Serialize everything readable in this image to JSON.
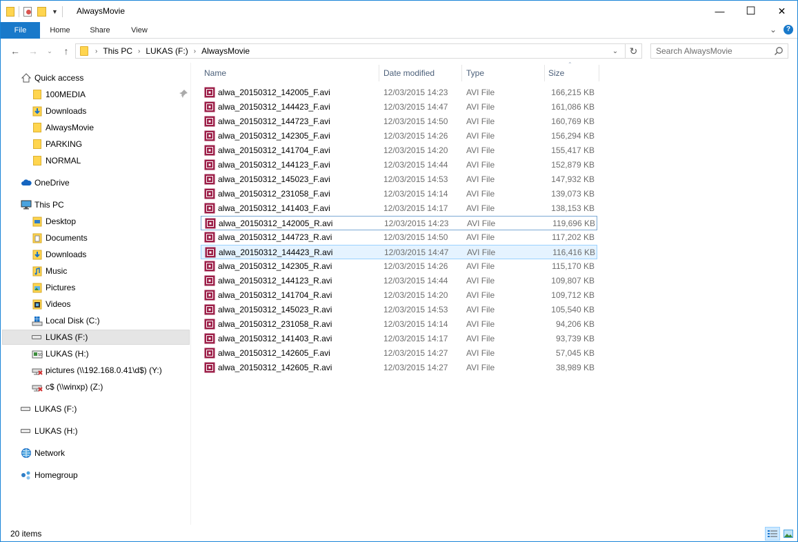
{
  "window": {
    "title": "AlwaysMovie",
    "controls": {
      "minimize": "—",
      "maximize": "☐",
      "close": "✕"
    }
  },
  "ribbon": {
    "tabs": [
      "File",
      "Home",
      "Share",
      "View"
    ],
    "expand_icon": "chevron-down-icon",
    "help_icon": "help-icon"
  },
  "address": {
    "crumbs": [
      "This PC",
      "LUKAS (F:)",
      "AlwaysMovie"
    ],
    "search_placeholder": "Search AlwaysMovie"
  },
  "nav": {
    "items": [
      {
        "label": "Quick access",
        "icon": "star-home-icon"
      },
      {
        "label": "100MEDIA",
        "icon": "folder-icon"
      },
      {
        "label": "Downloads",
        "icon": "downloads-icon"
      },
      {
        "label": "AlwaysMovie",
        "icon": "folder-icon"
      },
      {
        "label": "PARKING",
        "icon": "folder-icon"
      },
      {
        "label": "NORMAL",
        "icon": "folder-icon"
      },
      {
        "label": "OneDrive",
        "icon": "cloud-icon"
      },
      {
        "label": "This PC",
        "icon": "computer-icon"
      },
      {
        "label": "Desktop",
        "icon": "desktop-icon"
      },
      {
        "label": "Documents",
        "icon": "documents-icon"
      },
      {
        "label": "Downloads",
        "icon": "downloads-icon"
      },
      {
        "label": "Music",
        "icon": "music-icon"
      },
      {
        "label": "Pictures",
        "icon": "pictures-icon"
      },
      {
        "label": "Videos",
        "icon": "videos-icon"
      },
      {
        "label": "Local Disk (C:)",
        "icon": "windows-drive-icon"
      },
      {
        "label": "LUKAS (F:)",
        "icon": "drive-icon"
      },
      {
        "label": "LUKAS (H:)",
        "icon": "usb-drive-icon"
      },
      {
        "label": "pictures (\\\\192.168.0.41\\d$) (Y:)",
        "icon": "network-drive-disconnected-icon"
      },
      {
        "label": "c$ (\\\\winxp) (Z:)",
        "icon": "network-drive-disconnected-icon"
      },
      {
        "label": "LUKAS (F:)",
        "icon": "drive-icon"
      },
      {
        "label": "LUKAS (H:)",
        "icon": "drive-icon"
      },
      {
        "label": "Network",
        "icon": "network-icon"
      },
      {
        "label": "Homegroup",
        "icon": "homegroup-icon"
      }
    ],
    "selected_index": 15
  },
  "columns": {
    "name": "Name",
    "date": "Date modified",
    "type": "Type",
    "size": "Size"
  },
  "files": [
    {
      "name": "alwa_20150312_142005_F.avi",
      "date": "12/03/2015 14:23",
      "type": "AVI File",
      "size": "166,215 KB"
    },
    {
      "name": "alwa_20150312_144423_F.avi",
      "date": "12/03/2015 14:47",
      "type": "AVI File",
      "size": "161,086 KB"
    },
    {
      "name": "alwa_20150312_144723_F.avi",
      "date": "12/03/2015 14:50",
      "type": "AVI File",
      "size": "160,769 KB"
    },
    {
      "name": "alwa_20150312_142305_F.avi",
      "date": "12/03/2015 14:26",
      "type": "AVI File",
      "size": "156,294 KB"
    },
    {
      "name": "alwa_20150312_141704_F.avi",
      "date": "12/03/2015 14:20",
      "type": "AVI File",
      "size": "155,417 KB"
    },
    {
      "name": "alwa_20150312_144123_F.avi",
      "date": "12/03/2015 14:44",
      "type": "AVI File",
      "size": "152,879 KB"
    },
    {
      "name": "alwa_20150312_145023_F.avi",
      "date": "12/03/2015 14:53",
      "type": "AVI File",
      "size": "147,932 KB"
    },
    {
      "name": "alwa_20150312_231058_F.avi",
      "date": "12/03/2015 14:14",
      "type": "AVI File",
      "size": "139,073 KB"
    },
    {
      "name": "alwa_20150312_141403_F.avi",
      "date": "12/03/2015 14:17",
      "type": "AVI File",
      "size": "138,153 KB"
    },
    {
      "name": "alwa_20150312_142005_R.avi",
      "date": "12/03/2015 14:23",
      "type": "AVI File",
      "size": "119,696 KB"
    },
    {
      "name": "alwa_20150312_144723_R.avi",
      "date": "12/03/2015 14:50",
      "type": "AVI File",
      "size": "117,202 KB"
    },
    {
      "name": "alwa_20150312_144423_R.avi",
      "date": "12/03/2015 14:47",
      "type": "AVI File",
      "size": "116,416 KB"
    },
    {
      "name": "alwa_20150312_142305_R.avi",
      "date": "12/03/2015 14:26",
      "type": "AVI File",
      "size": "115,170 KB"
    },
    {
      "name": "alwa_20150312_144123_R.avi",
      "date": "12/03/2015 14:44",
      "type": "AVI File",
      "size": "109,807 KB"
    },
    {
      "name": "alwa_20150312_141704_R.avi",
      "date": "12/03/2015 14:20",
      "type": "AVI File",
      "size": "109,712 KB"
    },
    {
      "name": "alwa_20150312_145023_R.avi",
      "date": "12/03/2015 14:53",
      "type": "AVI File",
      "size": "105,540 KB"
    },
    {
      "name": "alwa_20150312_231058_R.avi",
      "date": "12/03/2015 14:14",
      "type": "AVI File",
      "size": "94,206 KB"
    },
    {
      "name": "alwa_20150312_141403_R.avi",
      "date": "12/03/2015 14:17",
      "type": "AVI File",
      "size": "93,739 KB"
    },
    {
      "name": "alwa_20150312_142605_F.avi",
      "date": "12/03/2015 14:27",
      "type": "AVI File",
      "size": "57,045 KB"
    },
    {
      "name": "alwa_20150312_142605_R.avi",
      "date": "12/03/2015 14:27",
      "type": "AVI File",
      "size": "38,989 KB"
    }
  ],
  "focused_row_index": 9,
  "hot_row_index": 11,
  "status": {
    "item_count": "20 items"
  },
  "colors": {
    "accent": "#1979ca",
    "header_text": "#4c607a",
    "avi_icon": "#9c1f48"
  }
}
